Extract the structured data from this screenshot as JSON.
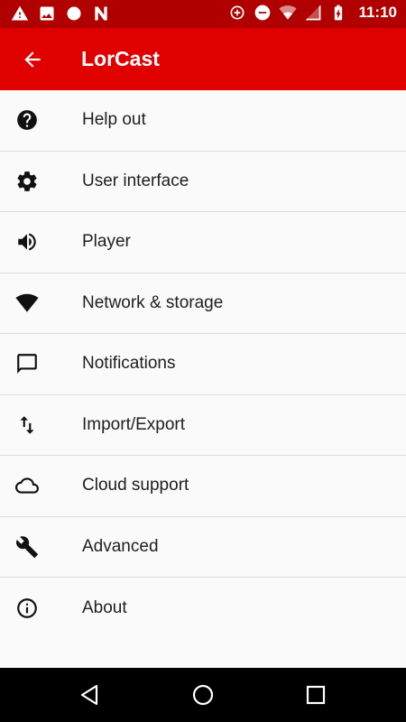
{
  "status_bar": {
    "time": "11:10",
    "left_icons": [
      "warning-icon",
      "image-icon",
      "circle-icon",
      "n-icon"
    ],
    "right_icons": [
      "data-saver-icon",
      "do-not-disturb-icon",
      "wifi-icon",
      "signal-icon",
      "battery-charging-icon"
    ]
  },
  "app_bar": {
    "title": "LorCast",
    "back_icon": "arrow-back-icon",
    "color": "#e00000"
  },
  "menu": {
    "items": [
      {
        "label": "Help out",
        "icon": "help-icon"
      },
      {
        "label": "User interface",
        "icon": "gear-icon"
      },
      {
        "label": "Player",
        "icon": "volume-icon"
      },
      {
        "label": "Network & storage",
        "icon": "wifi-icon"
      },
      {
        "label": "Notifications",
        "icon": "chat-bubble-icon"
      },
      {
        "label": "Import/Export",
        "icon": "import-export-icon"
      },
      {
        "label": "Cloud support",
        "icon": "cloud-icon"
      },
      {
        "label": "Advanced",
        "icon": "wrench-icon"
      },
      {
        "label": "About",
        "icon": "info-icon"
      }
    ]
  },
  "nav_bar": {
    "buttons": [
      "back-nav-icon",
      "home-nav-icon",
      "recents-nav-icon"
    ]
  }
}
